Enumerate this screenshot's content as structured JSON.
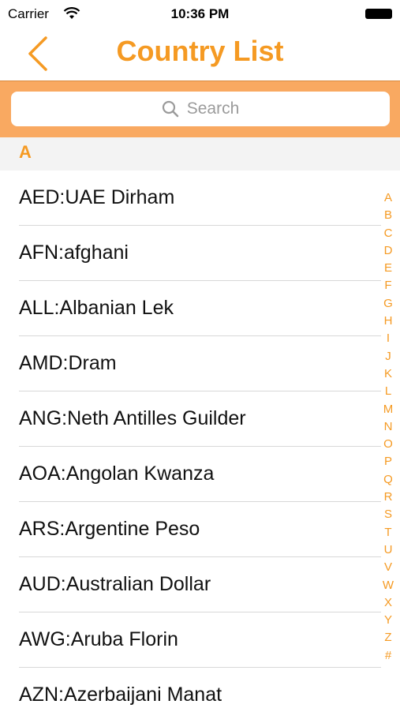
{
  "status_bar": {
    "carrier": "Carrier",
    "time": "10:36 PM"
  },
  "nav": {
    "title": "Country List"
  },
  "search": {
    "placeholder": "Search"
  },
  "section": {
    "letter": "A"
  },
  "rows": [
    "AED:UAE Dirham",
    "AFN:afghani",
    "ALL:Albanian Lek",
    "AMD:Dram",
    "ANG:Neth Antilles Guilder",
    "AOA:Angolan Kwanza",
    "ARS:Argentine Peso",
    "AUD:Australian Dollar",
    "AWG:Aruba Florin",
    "AZN:Azerbaijani Manat"
  ],
  "index": [
    "A",
    "B",
    "C",
    "D",
    "E",
    "F",
    "G",
    "H",
    "I",
    "J",
    "K",
    "L",
    "M",
    "N",
    "O",
    "P",
    "Q",
    "R",
    "S",
    "T",
    "U",
    "V",
    "W",
    "X",
    "Y",
    "Z",
    "#"
  ],
  "colors": {
    "accent": "#f59a23",
    "search_band": "#f9a961",
    "section_bg": "#f3f3f3"
  }
}
